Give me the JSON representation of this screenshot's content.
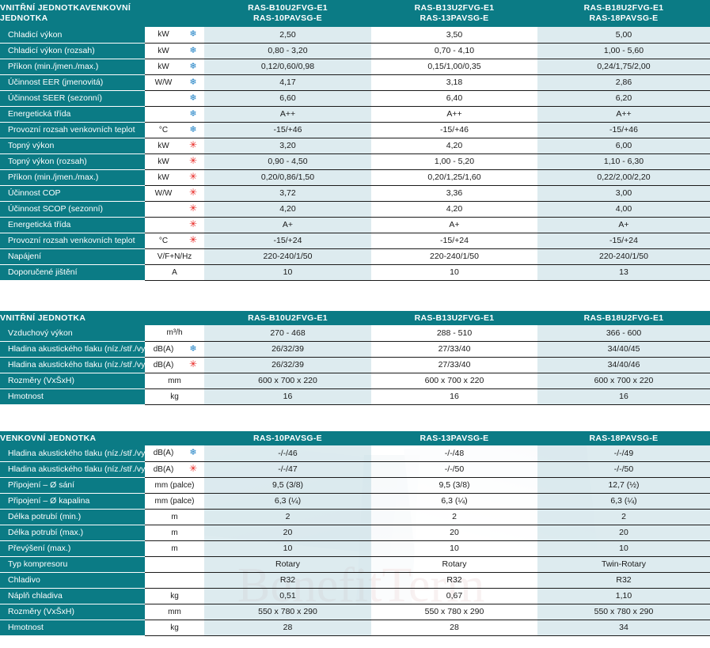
{
  "watermark": {
    "text": "BenefitTerm",
    "color": "#d2a1a1"
  },
  "theme": {
    "header_bg": "#0b7b85",
    "value_shade": "#d6e6ec",
    "cool_icon": "#1b7fc4",
    "heat_icon": "#e8231f"
  },
  "tables": [
    {
      "id": "table-indoor-outdoor-combined",
      "header": {
        "title_line1": "VNITŘNÍ JEDNOTKA",
        "title_line2": "VENKOVNÍ JEDNOTKA",
        "models": [
          {
            "line1": "RAS-B10U2FVG-E1",
            "line2": "RAS-10PAVSG-E"
          },
          {
            "line1": "RAS-B13U2FVG-E1",
            "line2": "RAS-13PAVSG-E"
          },
          {
            "line1": "RAS-B18U2FVG-E1",
            "line2": "RAS-18PAVSG-E"
          }
        ]
      },
      "rows": [
        {
          "label": "Chladicí výkon",
          "unit": "kW",
          "mode": "cool",
          "values": [
            "2,50",
            "3,50",
            "5,00"
          ]
        },
        {
          "label": "Chladicí výkon (rozsah)",
          "unit": "kW",
          "mode": "cool",
          "values": [
            "0,80 - 3,20",
            "0,70 - 4,10",
            "1,00 - 5,60"
          ]
        },
        {
          "label": "Příkon (min./jmen./max.)",
          "unit": "kW",
          "mode": "cool",
          "values": [
            "0,12/0,60/0,98",
            "0,15/1,00/0,35",
            "0,24/1,75/2,00"
          ]
        },
        {
          "label": "Účinnost EER (jmenovitá)",
          "unit": "W/W",
          "mode": "cool",
          "values": [
            "4,17",
            "3,18",
            "2,86"
          ]
        },
        {
          "label": "Účinnost SEER (sezonní)",
          "unit": "",
          "mode": "cool",
          "values": [
            "6,60",
            "6,40",
            "6,20"
          ]
        },
        {
          "label": "Energetická třída",
          "unit": "",
          "mode": "cool",
          "values": [
            "A++",
            "A++",
            "A++"
          ]
        },
        {
          "label": "Provozní rozsah venkovních teplot",
          "unit": "°C",
          "mode": "cool",
          "values": [
            "-15/+46",
            "-15/+46",
            "-15/+46"
          ]
        },
        {
          "label": "Topný výkon",
          "unit": "kW",
          "mode": "heat",
          "values": [
            "3,20",
            "4,20",
            "6,00"
          ]
        },
        {
          "label": "Topný výkon (rozsah)",
          "unit": "kW",
          "mode": "heat",
          "values": [
            "0,90 - 4,50",
            "1,00 - 5,20",
            "1,10 - 6,30"
          ]
        },
        {
          "label": "Příkon (min./jmen./max.)",
          "unit": "kW",
          "mode": "heat",
          "values": [
            "0,20/0,86/1,50",
            "0,20/1,25/1,60",
            "0,22/2,00/2,20"
          ]
        },
        {
          "label": "Účinnost COP",
          "unit": "W/W",
          "mode": "heat",
          "values": [
            "3,72",
            "3,36",
            "3,00"
          ]
        },
        {
          "label": "Účinnost SCOP (sezonní)",
          "unit": "",
          "mode": "heat",
          "values": [
            "4,20",
            "4,20",
            "4,00"
          ]
        },
        {
          "label": "Energetická třída",
          "unit": "",
          "mode": "heat",
          "values": [
            "A+",
            "A+",
            "A+"
          ]
        },
        {
          "label": "Provozní rozsah venkovních teplot",
          "unit": "°C",
          "mode": "heat",
          "values": [
            "-15/+24",
            "-15/+24",
            "-15/+24"
          ]
        },
        {
          "label": "Napájení",
          "unit": "V/F+N/Hz",
          "mode": "none",
          "unit_wide": true,
          "values": [
            "220-240/1/50",
            "220-240/1/50",
            "220-240/1/50"
          ]
        },
        {
          "label": "Doporučené jištění",
          "unit": "A",
          "mode": "none",
          "unit_wide": true,
          "values": [
            "10",
            "10",
            "13"
          ]
        }
      ]
    },
    {
      "id": "table-indoor-unit",
      "header": {
        "title_line1": "VNITŘNÍ JEDNOTKA",
        "title_line2": "",
        "models": [
          {
            "line1": "RAS-B10U2FVG-E1",
            "line2": ""
          },
          {
            "line1": "RAS-B13U2FVG-E1",
            "line2": ""
          },
          {
            "line1": "RAS-B18U2FVG-E1",
            "line2": ""
          }
        ]
      },
      "rows": [
        {
          "label": "Vzduchový výkon",
          "unit": "m³/h",
          "mode": "none",
          "unit_wide": true,
          "values": [
            "270 - 468",
            "288 - 510",
            "366 - 600"
          ]
        },
        {
          "label": "Hladina akustického tlaku (níz./stř./vys.)",
          "unit": "dB(A)",
          "mode": "cool",
          "values": [
            "26/32/39",
            "27/33/40",
            "34/40/45"
          ]
        },
        {
          "label": "Hladina akustického tlaku (níz./stř./vys.)",
          "unit": "dB(A)",
          "mode": "heat",
          "values": [
            "26/32/39",
            "27/33/40",
            "34/40/46"
          ]
        },
        {
          "label": "Rozměry (VxŠxH)",
          "unit": "mm",
          "mode": "none",
          "unit_wide": true,
          "values": [
            "600 x 700 x 220",
            "600 x 700 x 220",
            "600 x 700 x 220"
          ]
        },
        {
          "label": "Hmotnost",
          "unit": "kg",
          "mode": "none",
          "unit_wide": true,
          "values": [
            "16",
            "16",
            "16"
          ]
        }
      ]
    },
    {
      "id": "table-outdoor-unit",
      "header": {
        "title_line1": "VENKOVNÍ JEDNOTKA",
        "title_line2": "",
        "models": [
          {
            "line1": "RAS-10PAVSG-E",
            "line2": ""
          },
          {
            "line1": "RAS-13PAVSG-E",
            "line2": ""
          },
          {
            "line1": "RAS-18PAVSG-E",
            "line2": ""
          }
        ]
      },
      "rows": [
        {
          "label": "Hladina akustického tlaku (níz./stř./vys.)",
          "unit": "dB(A)",
          "mode": "cool",
          "values": [
            "-/-/46",
            "-/-/48",
            "-/-/49"
          ]
        },
        {
          "label": "Hladina akustického tlaku (níz./stř./vys.)",
          "unit": "dB(A)",
          "mode": "heat",
          "values": [
            "-/-/47",
            "-/-/50",
            "-/-/50"
          ]
        },
        {
          "label": "Připojení – Ø sání",
          "unit": "mm (palce)",
          "mode": "none",
          "unit_wide": true,
          "values": [
            "9,5 (3/8)",
            "9,5 (3/8)",
            "12,7 (½)"
          ]
        },
        {
          "label": "Připojení – Ø kapalina",
          "unit": "mm (palce)",
          "mode": "none",
          "unit_wide": true,
          "values": [
            "6,3 (¼)",
            "6,3 (¼)",
            "6,3 (¼)"
          ]
        },
        {
          "label": "Délka potrubí (min.)",
          "unit": "m",
          "mode": "none",
          "unit_wide": true,
          "values": [
            "2",
            "2",
            "2"
          ]
        },
        {
          "label": "Délka potrubí (max.)",
          "unit": "m",
          "mode": "none",
          "unit_wide": true,
          "values": [
            "20",
            "20",
            "20"
          ]
        },
        {
          "label": "Převýšení (max.)",
          "unit": "m",
          "mode": "none",
          "unit_wide": true,
          "values": [
            "10",
            "10",
            "10"
          ]
        },
        {
          "label": "Typ kompresoru",
          "unit": "",
          "mode": "none",
          "unit_wide": true,
          "values": [
            "Rotary",
            "Rotary",
            "Twin-Rotary"
          ]
        },
        {
          "label": "Chladivo",
          "unit": "",
          "mode": "none",
          "unit_wide": true,
          "values": [
            "R32",
            "R32",
            "R32"
          ]
        },
        {
          "label": "Náplň chladiva",
          "unit": "kg",
          "mode": "none",
          "unit_wide": true,
          "values": [
            "0,51",
            "0,67",
            "1,10"
          ]
        },
        {
          "label": "Rozměry (VxŠxH)",
          "unit": "mm",
          "mode": "none",
          "unit_wide": true,
          "values": [
            "550 x 780 x 290",
            "550 x 780 x 290",
            "550 x 780 x 290"
          ]
        },
        {
          "label": "Hmotnost",
          "unit": "kg",
          "mode": "none",
          "unit_wide": true,
          "values": [
            "28",
            "28",
            "34"
          ]
        }
      ]
    }
  ]
}
